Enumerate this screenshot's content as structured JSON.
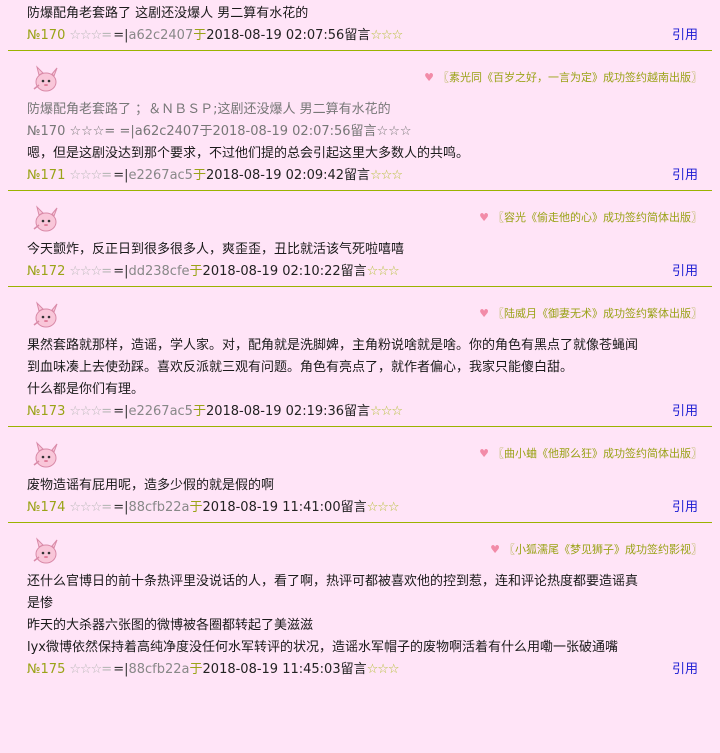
{
  "comments": [
    {
      "id": "c170",
      "lines": [
        "防爆配角老套路了 这剧还没爆人 男二算有水花的"
      ],
      "meta": {
        "no": "№170",
        "stars": "☆☆☆=",
        "eq": " =|",
        "hash": "a62c2407",
        "yu": "于",
        "date": "2018-08-19 02:07:56",
        "liuyan": "留言",
        "stars2": "☆☆☆"
      },
      "reply": "引用"
    },
    {
      "id": "c171",
      "sign": "〖素光同《百岁之好，一言为定》成功签约越南出版〗",
      "quote_lines": [
        "防爆配角老套路了 ；＆ＮＢＳＰ;这剧还没爆人 男二算有水花的",
        "№170 ☆☆☆= =|a62c2407于2018-08-19 02:07:56留言☆☆☆"
      ],
      "lines": [
        "嗯，但是这剧没达到那个要求，不过他们提的总会引起这里大多数人的共鸣。"
      ],
      "meta": {
        "no": "№171",
        "stars": "☆☆☆=",
        "eq": " =|",
        "hash": "e2267ac5",
        "yu": "于",
        "date": "2018-08-19 02:09:42",
        "liuyan": "留言",
        "stars2": "☆☆☆"
      },
      "reply": "引用"
    },
    {
      "id": "c172",
      "sign": "〖容光《偷走他的心》成功签约简体出版〗",
      "lines": [
        "今天颤炸，反正日到很多很多人，爽歪歪，丑比就活该气死啦嘻嘻"
      ],
      "meta": {
        "no": "№172",
        "stars": "☆☆☆=",
        "eq": " =|",
        "hash": "dd238cfe",
        "yu": "于",
        "date": "2018-08-19 02:10:22",
        "liuyan": "留言",
        "stars2": "☆☆☆"
      },
      "reply": "引用"
    },
    {
      "id": "c173",
      "sign": "〖陆威月《御妻无术》成功签约繁体出版〗",
      "lines": [
        "果然套路就那样，造谣，学人家。对，配角就是洗脚婢，主角粉说啥就是啥。你的角色有黑点了就像苍蝇闻",
        "到血味凑上去使劲踩。喜欢反派就三观有问题。角色有亮点了，就作者偏心，我家只能傻白甜。",
        "什么都是你们有理。"
      ],
      "meta": {
        "no": "№173",
        "stars": "☆☆☆=",
        "eq": " =|",
        "hash": "e2267ac5",
        "yu": "于",
        "date": "2018-08-19 02:19:36",
        "liuyan": "留言",
        "stars2": "☆☆☆"
      },
      "reply": "引用"
    },
    {
      "id": "c174",
      "sign": "〖曲小蛐《他那么狂》成功签约简体出版〗",
      "lines": [
        "废物造谣有屁用呢，造多少假的就是假的啊"
      ],
      "meta": {
        "no": "№174",
        "stars": "☆☆☆=",
        "eq": " =|",
        "hash": "88cfb22a",
        "yu": "于",
        "date": "2018-08-19 11:41:00",
        "liuyan": "留言",
        "stars2": "☆☆☆"
      },
      "reply": "引用"
    },
    {
      "id": "c175",
      "sign": "〖小狐濡尾《梦见狮子》成功签约影视〗",
      "lines": [
        "还什么官博日的前十条热评里没说话的人，看了啊，热评可都被喜欢他的控到惹，连和评论热度都要造谣真",
        "是惨",
        "昨天的大杀器六张图的微博被各圈都转起了美滋滋",
        "lyx微博依然保持着高纯净度没任何水军转评的状况，造谣水军帽子的废物啊活着有什么用嘞一张破通嘴"
      ],
      "meta": {
        "no": "№175",
        "stars": "☆☆☆=",
        "eq": " =|",
        "hash": "88cfb22a",
        "yu": "于",
        "date": "2018-08-19 11:45:03",
        "liuyan": "留言",
        "stars2": "☆☆☆"
      },
      "reply": "引用"
    }
  ]
}
